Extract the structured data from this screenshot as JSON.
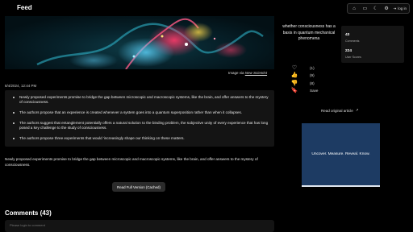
{
  "header": {
    "title": "Feed",
    "login_label": "log in"
  },
  "article": {
    "image_credit_prefix": "Image via",
    "image_credit_source": "New Scientist",
    "date": "8/4/2024, 12:44 PM",
    "summary_points": [
      "Newly proposed experiments promise to bridge the gap between microscopic and macroscopic systems, like the brain, and offer answers to the mystery of consciousness.",
      "The authors propose that an experience is created whenever a system goes into a quantum superposition rather than when it collapses.",
      "The authors suggest that entanglement potentially offers a natural solution to the binding problem, the subjective unity of every experience that has long posed a key challenge to the study of consciousness.",
      "The authors propose three experiments that would 'increasingly shape our thinking on these matters."
    ],
    "body": "Newly proposed experiments promise to bridge the gap between microscopic and macroscopic systems, like the brain, and offer answers to the mystery of consciousness.",
    "read_full_label": "Read Full Version (Cached)"
  },
  "comments": {
    "title": "Comments (43)",
    "placeholder": "Please login to comment"
  },
  "sidebar": {
    "quote": "whether consciousness has a basis in quantum mechanical phenomena",
    "stats": [
      {
        "value": "43",
        "label": "Comments"
      },
      {
        "value": "224",
        "label": "User Scores"
      }
    ],
    "reactions": [
      {
        "icon": "heart-icon",
        "glyph": "♡",
        "value": "(1)"
      },
      {
        "icon": "thumbs-up-icon",
        "glyph": "👍",
        "value": "(9)"
      },
      {
        "icon": "thumbs-down-icon",
        "glyph": "👎",
        "value": "(8)"
      },
      {
        "icon": "bookmark-icon",
        "glyph": "🔖",
        "value": "Save"
      }
    ],
    "read_original_label": "Read original article",
    "ad_text": "Uncover. Measure. Reveal. Know."
  },
  "colors": {
    "background": "#000000",
    "card": "#141414",
    "ad_background": "#1d3b63"
  }
}
